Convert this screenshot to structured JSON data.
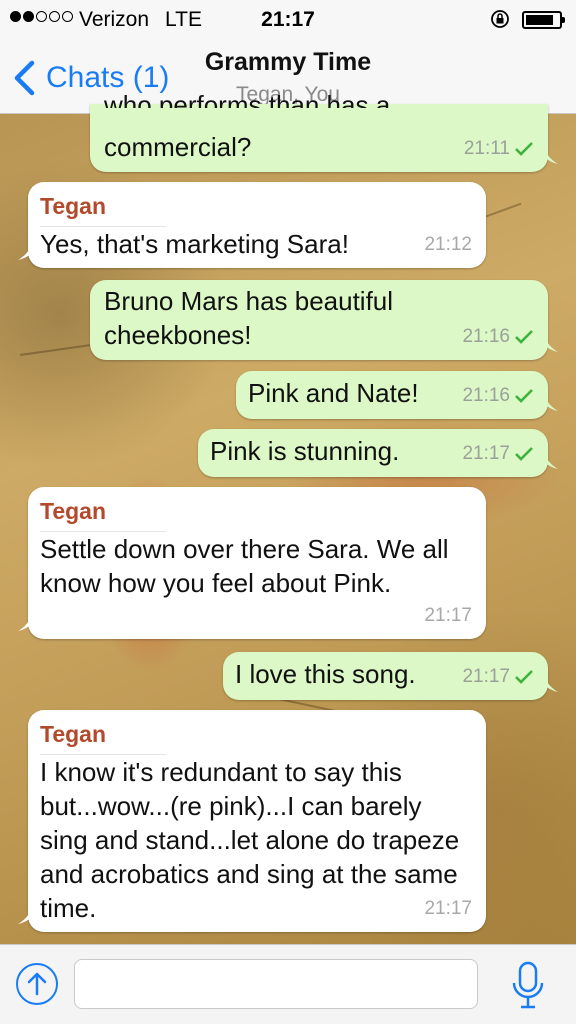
{
  "status_bar": {
    "carrier": "Verizon",
    "network": "LTE",
    "time": "21:17"
  },
  "nav": {
    "back_label": "Chats (1)",
    "title": "Grammy Time",
    "subtitle": "Tegan, You"
  },
  "messages": [
    {
      "id": "m1",
      "direction": "outgoing",
      "text": "commercial?",
      "partial_text_above": "who performs than has a",
      "time": "21:11",
      "read": true
    },
    {
      "id": "m2",
      "direction": "incoming",
      "sender": "Tegan",
      "text": "Yes, that's marketing Sara!",
      "time": "21:12"
    },
    {
      "id": "m3",
      "direction": "outgoing",
      "text": "Bruno Mars has beautiful cheekbones!",
      "time": "21:16",
      "read": true
    },
    {
      "id": "m4",
      "direction": "outgoing",
      "text": "Pink and Nate!",
      "time": "21:16",
      "read": true
    },
    {
      "id": "m5",
      "direction": "outgoing",
      "text": "Pink is stunning.",
      "time": "21:17",
      "read": true
    },
    {
      "id": "m6",
      "direction": "incoming",
      "sender": "Tegan",
      "text": "Settle down over there Sara. We all know how you feel about Pink.",
      "time": "21:17"
    },
    {
      "id": "m7",
      "direction": "outgoing",
      "text": "I love this song.",
      "time": "21:17",
      "read": true
    },
    {
      "id": "m8",
      "direction": "incoming",
      "sender": "Tegan",
      "text": "I know it's redundant to say this but...wow...(re pink)...I can barely sing and stand...let alone do trapeze and acrobatics and sing at the same time.",
      "time": "21:17"
    }
  ],
  "input": {
    "value": "",
    "placeholder": ""
  },
  "icons": {
    "back": "chevron-left-icon",
    "upload": "arrow-up-circle-icon",
    "mic": "microphone-icon",
    "read_receipt": "check-icon",
    "orientation_lock": "rotation-lock-icon",
    "battery": "battery-icon"
  },
  "colors": {
    "accent": "#1a7cf5",
    "outgoing_bubble": "#dcf8c6",
    "incoming_bubble": "#ffffff",
    "sender_name": "#b34a2c",
    "check": "#3db33d"
  }
}
